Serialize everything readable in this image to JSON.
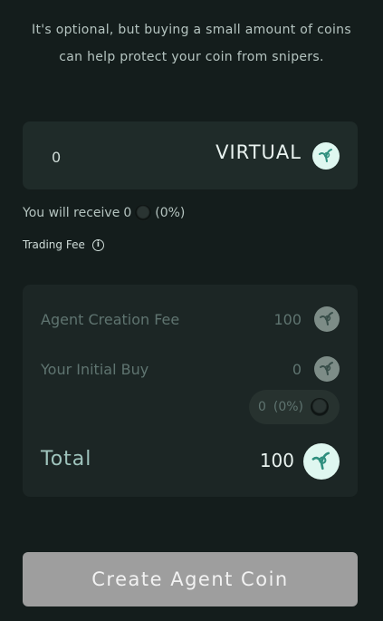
{
  "intro_text": "It's optional, but buying a small amount of coins can help protect your coin from snipers.",
  "amount": {
    "value": "0",
    "token": "VIRTUAL"
  },
  "receive": {
    "prefix": "You will receive",
    "amount": "0",
    "percent": "(0%)"
  },
  "trading_fee": {
    "label": "Trading Fee",
    "info_glyph": "i"
  },
  "summary": {
    "creation_fee": {
      "label": "Agent Creation Fee",
      "value": "100"
    },
    "initial_buy": {
      "label": "Your Initial Buy",
      "value": "0"
    },
    "initial_buy_tokens": {
      "amount": "0",
      "percent": "(0%)"
    },
    "total": {
      "label": "Total",
      "value": "100"
    }
  },
  "create_button": {
    "label": "Create Agent Coin"
  },
  "colors": {
    "background": "#141d1c",
    "card": "#1f2b29",
    "accent": "#9fc4bd",
    "button": "#9e9e9e"
  },
  "icons": {
    "token": "virtual-coin-icon",
    "agent_token": "agent-coin-icon",
    "info": "info-icon"
  }
}
